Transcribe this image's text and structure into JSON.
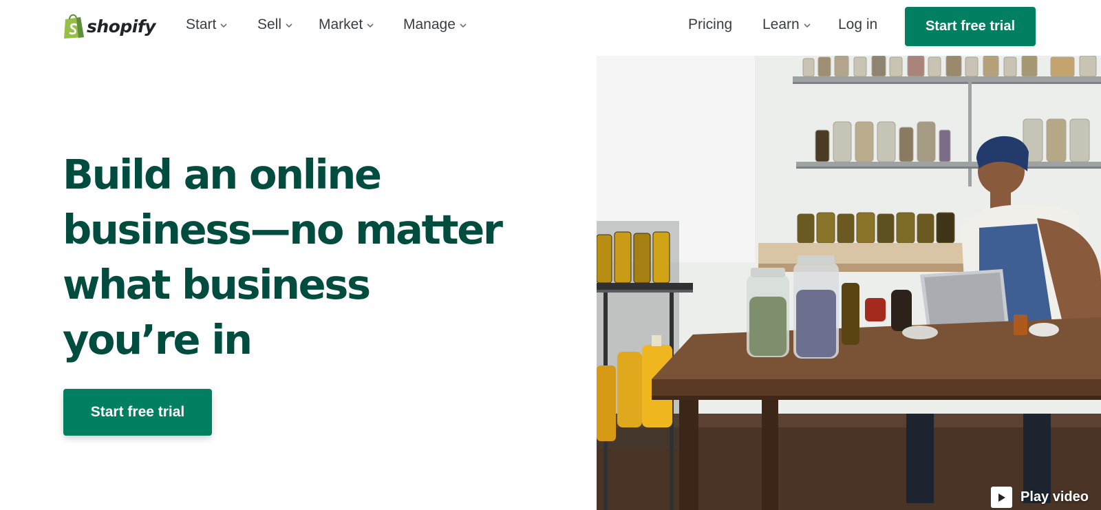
{
  "brand": {
    "name": "shopify",
    "logo_icon": "shopping-bag-icon",
    "logo_green": "#95bf47",
    "logo_dark_green": "#5e8e3e"
  },
  "nav": {
    "left": [
      {
        "label": "Start",
        "icon": "chevron-down-icon"
      },
      {
        "label": "Sell",
        "icon": "chevron-down-icon"
      },
      {
        "label": "Market",
        "icon": "chevron-down-icon"
      },
      {
        "label": "Manage",
        "icon": "chevron-down-icon"
      }
    ],
    "right": [
      {
        "label": "Pricing"
      },
      {
        "label": "Learn",
        "icon": "chevron-down-icon"
      },
      {
        "label": "Log in"
      }
    ],
    "cta_label": "Start free trial"
  },
  "hero": {
    "title_lines": [
      "Build an online",
      "business—no matter",
      "what business",
      "you’re in"
    ],
    "cta_label": "Start free trial",
    "play_video_label": "Play video",
    "play_icon": "play-icon"
  },
  "colors": {
    "accent": "#008060",
    "headline": "#004c3f",
    "nav_text": "#3a3c3f"
  }
}
